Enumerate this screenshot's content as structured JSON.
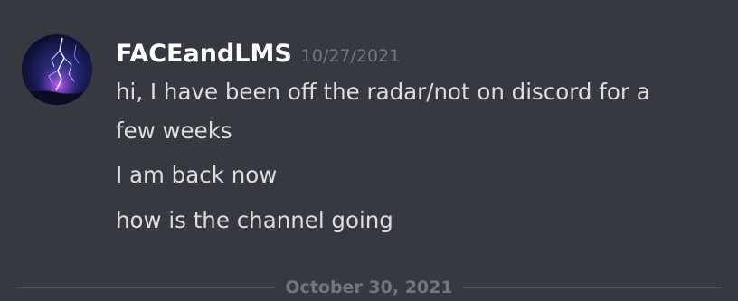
{
  "message": {
    "author": "FACEandLMS",
    "timestamp": "10/27/2021",
    "avatar_icon": "lightning-storm-avatar",
    "lines": [
      "hi, I have been off the radar/not on discord for a",
      "few weeks",
      "I am back now",
      "how is the channel going"
    ]
  },
  "date_divider": {
    "label": "October 30, 2021"
  },
  "colors": {
    "background": "#36393f",
    "username": "#ffffff",
    "message_text": "#dcddde",
    "muted_text": "#72767d",
    "divider_line": "#4f545c"
  }
}
